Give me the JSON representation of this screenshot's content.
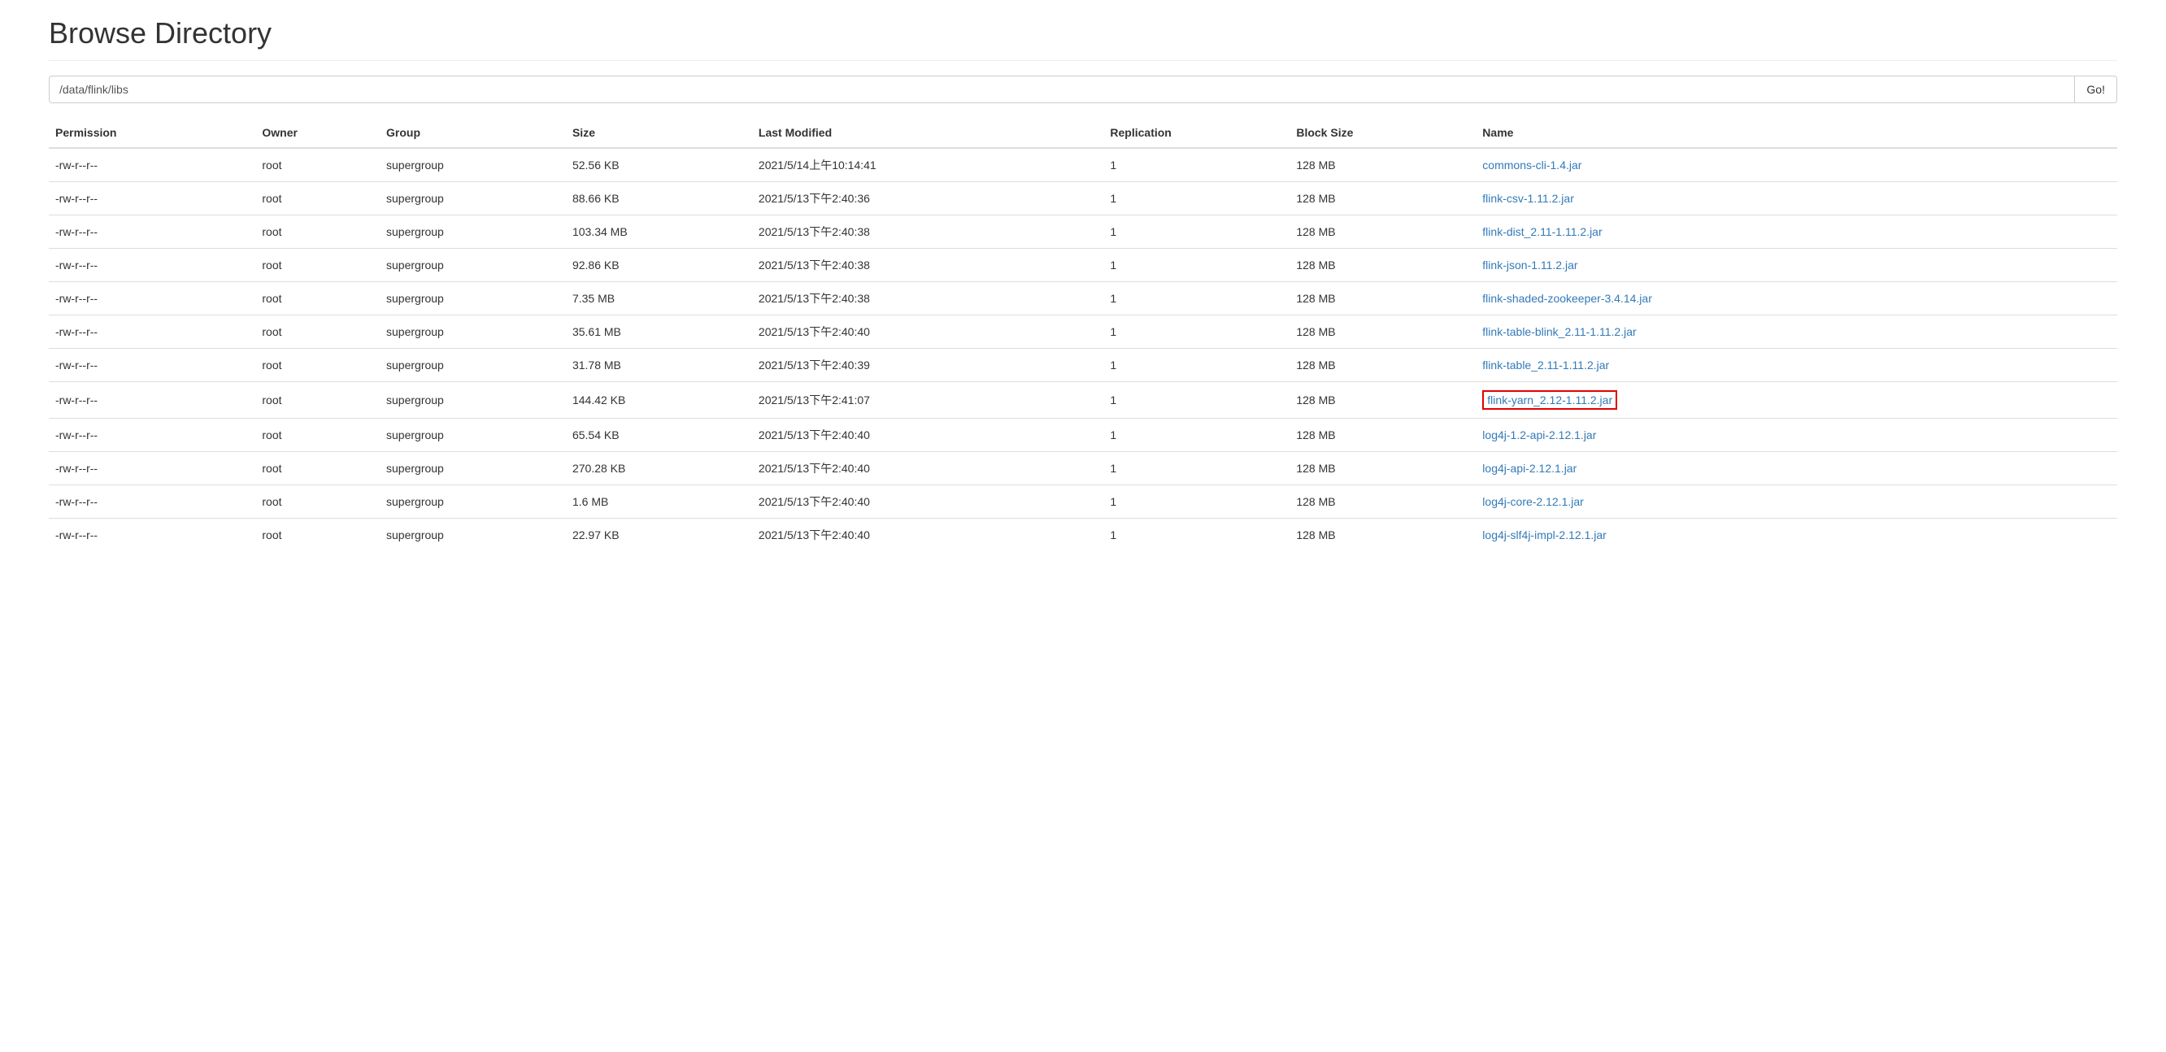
{
  "page": {
    "title": "Browse Directory"
  },
  "path": {
    "value": "/data/flink/libs",
    "go_label": "Go!"
  },
  "table": {
    "headers": {
      "permission": "Permission",
      "owner": "Owner",
      "group": "Group",
      "size": "Size",
      "last_modified": "Last Modified",
      "replication": "Replication",
      "block_size": "Block Size",
      "name": "Name"
    },
    "rows": [
      {
        "permission": "-rw-r--r--",
        "owner": "root",
        "group": "supergroup",
        "size": "52.56 KB",
        "last_modified": "2021/5/14上午10:14:41",
        "replication": "1",
        "block_size": "128 MB",
        "name": "commons-cli-1.4.jar",
        "highlighted": false
      },
      {
        "permission": "-rw-r--r--",
        "owner": "root",
        "group": "supergroup",
        "size": "88.66 KB",
        "last_modified": "2021/5/13下午2:40:36",
        "replication": "1",
        "block_size": "128 MB",
        "name": "flink-csv-1.11.2.jar",
        "highlighted": false
      },
      {
        "permission": "-rw-r--r--",
        "owner": "root",
        "group": "supergroup",
        "size": "103.34 MB",
        "last_modified": "2021/5/13下午2:40:38",
        "replication": "1",
        "block_size": "128 MB",
        "name": "flink-dist_2.11-1.11.2.jar",
        "highlighted": false
      },
      {
        "permission": "-rw-r--r--",
        "owner": "root",
        "group": "supergroup",
        "size": "92.86 KB",
        "last_modified": "2021/5/13下午2:40:38",
        "replication": "1",
        "block_size": "128 MB",
        "name": "flink-json-1.11.2.jar",
        "highlighted": false
      },
      {
        "permission": "-rw-r--r--",
        "owner": "root",
        "group": "supergroup",
        "size": "7.35 MB",
        "last_modified": "2021/5/13下午2:40:38",
        "replication": "1",
        "block_size": "128 MB",
        "name": "flink-shaded-zookeeper-3.4.14.jar",
        "highlighted": false
      },
      {
        "permission": "-rw-r--r--",
        "owner": "root",
        "group": "supergroup",
        "size": "35.61 MB",
        "last_modified": "2021/5/13下午2:40:40",
        "replication": "1",
        "block_size": "128 MB",
        "name": "flink-table-blink_2.11-1.11.2.jar",
        "highlighted": false
      },
      {
        "permission": "-rw-r--r--",
        "owner": "root",
        "group": "supergroup",
        "size": "31.78 MB",
        "last_modified": "2021/5/13下午2:40:39",
        "replication": "1",
        "block_size": "128 MB",
        "name": "flink-table_2.11-1.11.2.jar",
        "highlighted": false
      },
      {
        "permission": "-rw-r--r--",
        "owner": "root",
        "group": "supergroup",
        "size": "144.42 KB",
        "last_modified": "2021/5/13下午2:41:07",
        "replication": "1",
        "block_size": "128 MB",
        "name": "flink-yarn_2.12-1.11.2.jar",
        "highlighted": true
      },
      {
        "permission": "-rw-r--r--",
        "owner": "root",
        "group": "supergroup",
        "size": "65.54 KB",
        "last_modified": "2021/5/13下午2:40:40",
        "replication": "1",
        "block_size": "128 MB",
        "name": "log4j-1.2-api-2.12.1.jar",
        "highlighted": false
      },
      {
        "permission": "-rw-r--r--",
        "owner": "root",
        "group": "supergroup",
        "size": "270.28 KB",
        "last_modified": "2021/5/13下午2:40:40",
        "replication": "1",
        "block_size": "128 MB",
        "name": "log4j-api-2.12.1.jar",
        "highlighted": false
      },
      {
        "permission": "-rw-r--r--",
        "owner": "root",
        "group": "supergroup",
        "size": "1.6 MB",
        "last_modified": "2021/5/13下午2:40:40",
        "replication": "1",
        "block_size": "128 MB",
        "name": "log4j-core-2.12.1.jar",
        "highlighted": false
      },
      {
        "permission": "-rw-r--r--",
        "owner": "root",
        "group": "supergroup",
        "size": "22.97 KB",
        "last_modified": "2021/5/13下午2:40:40",
        "replication": "1",
        "block_size": "128 MB",
        "name": "log4j-slf4j-impl-2.12.1.jar",
        "highlighted": false
      }
    ]
  }
}
